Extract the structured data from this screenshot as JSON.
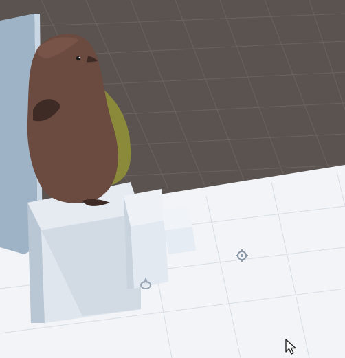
{
  "scene": {
    "colors": {
      "background": "#5b5350",
      "grid_line": "#6e6663",
      "floor_white": "#f2f4f7",
      "panel_blue": "#9fb3c6",
      "block_light": "#e6ebf1",
      "block_shade": "#b9c6d3",
      "penguin_brown": "#6b4a40",
      "penguin_dark": "#3f2b26",
      "penguin_belly": "#8a8a3a"
    },
    "icons": {
      "gizmo": "gear-icon",
      "pointer": "mouse-cursor-icon",
      "marker": "ring-marker-icon"
    }
  }
}
